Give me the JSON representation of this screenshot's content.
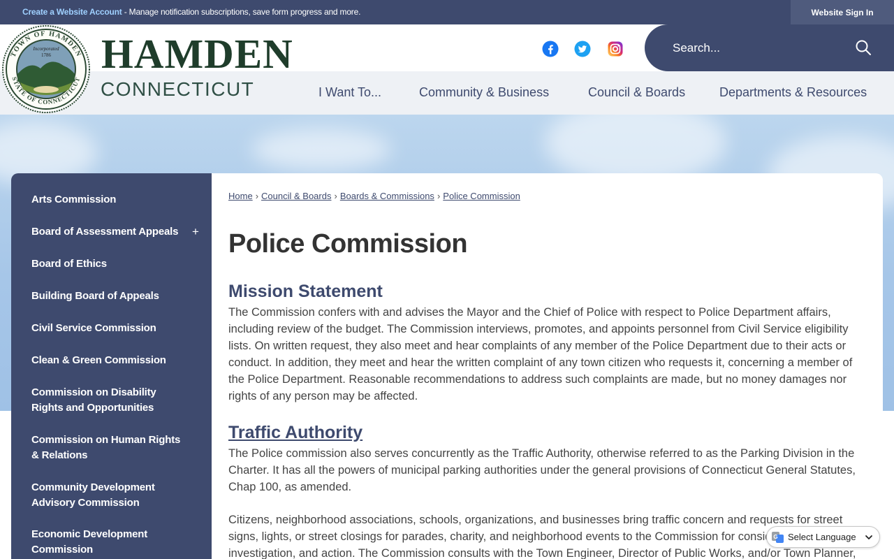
{
  "topbar": {
    "create_account_link": "Create a Website Account",
    "message": " - Manage notification subscriptions, save form progress and more.",
    "signin_label": "Website Sign In"
  },
  "brand": {
    "name": "HAMDEN",
    "state": "CONNECTICUT",
    "seal_top_text": "TOWN OF HAMDEN",
    "seal_bottom_text": "STATE OF CONNECTICUT",
    "seal_incorporated": "Incorporated",
    "seal_year": "1786"
  },
  "social": {
    "facebook_icon": "facebook-icon",
    "twitter_icon": "twitter-icon",
    "instagram_icon": "instagram-icon"
  },
  "search": {
    "placeholder": "Search...",
    "icon": "search-icon"
  },
  "nav": {
    "items": [
      "I Want To...",
      "Community & Business",
      "Council & Boards",
      "Departments & Resources"
    ]
  },
  "sidebar": {
    "items": [
      {
        "label": "Arts Commission"
      },
      {
        "label": "Board of Assessment Appeals",
        "expander": "+"
      },
      {
        "label": "Board of Ethics"
      },
      {
        "label": "Building Board of Appeals"
      },
      {
        "label": "Civil Service Commission"
      },
      {
        "label": "Clean & Green Commission"
      },
      {
        "label": "Commission on Disability Rights and Opportunities"
      },
      {
        "label": "Commission on Human Rights & Relations"
      },
      {
        "label": "Community Development Advisory Commission"
      },
      {
        "label": "Economic Development Commission"
      }
    ]
  },
  "breadcrumb": {
    "items": [
      "Home",
      "Council & Boards",
      "Boards & Commissions",
      "Police Commission"
    ],
    "separator": "›"
  },
  "main": {
    "title": "Police Commission",
    "mission_heading": "Mission Statement",
    "mission_text": "The Commission confers with and advises the Mayor and the Chief of Police with respect to Police Department affairs, including review of the budget. The Commission interviews, promotes, and appoints personnel from Civil Service eligibility lists. On written request, they also meet and hear complaints of any member of the Police Department due to their acts or conduct. In addition, they meet and hear the written complaint of any town citizen who requests it, concerning a member of the Police Department. Reasonable recommendations to address such complaints are made, but no money damages nor rights of any person may be affected.",
    "traffic_heading": "Traffic Authority",
    "traffic_text_1": "The Police commission also serves concurrently as the Traffic Authority, otherwise referred to as the Parking Division in the Charter. It has all the powers of municipal parking authorities under the general provisions of Connecticut General Statutes, Chap 100, as amended.",
    "traffic_text_2": "Citizens, neighborhood associations, schools, organizations, and businesses bring traffic concern and requests for street signs, lights, or street closings for parades, charity, and neighborhood events to the Commission for consideration, investigation, and action. The Commission consults with the Town Engineer, Director of Public Works, and/or Town Planner,"
  },
  "translate": {
    "label": "Select Language"
  },
  "colors": {
    "primary": "#3e4a6e",
    "brand_green": "#1f3d2b",
    "link_light": "#9fd0ff"
  }
}
